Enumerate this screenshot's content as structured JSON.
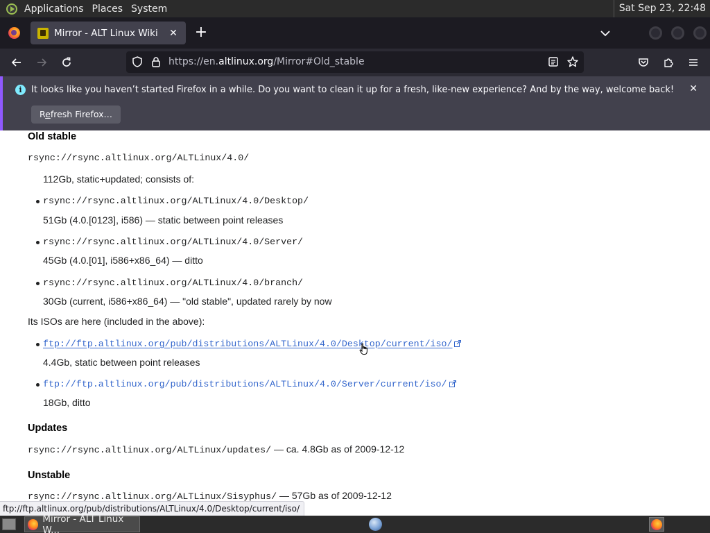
{
  "desktop": {
    "menu": [
      "Applications",
      "Places",
      "System"
    ],
    "clock": "Sat Sep 23, 22:48"
  },
  "browser": {
    "tab_title": "Mirror - ALT Linux Wiki",
    "url_scheme": "https://en.",
    "url_host": "altlinux.org",
    "url_path": "/Mirror#Old_stable",
    "notification": {
      "message": "It looks like you haven’t started Firefox in a while. Do you want to clean it up for a fresh, like-new experience? And by the way, welcome back!",
      "button_pre": "R",
      "button_accel": "e",
      "button_post": "fresh Firefox…"
    },
    "status_url": "ftp://ftp.altlinux.org/pub/distributions/ALTLinux/4.0/Desktop/current/iso/"
  },
  "page": {
    "old_stable": {
      "heading": "Old stable",
      "rsync": "rsync://rsync.altlinux.org/ALTLinux/4.0/",
      "summary": "112Gb, static+updated; consists of:",
      "items": [
        {
          "path": "rsync://rsync.altlinux.org/ALTLinux/4.0/Desktop/",
          "desc": "51Gb (4.0.[0123], i586) — static between point releases"
        },
        {
          "path": "rsync://rsync.altlinux.org/ALTLinux/4.0/Server/",
          "desc": "45Gb (4.0.[01], i586+x86_64) — ditto"
        },
        {
          "path": "rsync://rsync.altlinux.org/ALTLinux/4.0/branch/",
          "desc": "30Gb (current, i586+x86_64) — \"old stable\", updated rarely by now"
        }
      ],
      "isos_intro": "Its ISOs are here (included in the above):",
      "isos": [
        {
          "url": "ftp://ftp.altlinux.org/pub/distributions/ALTLinux/4.0/Desktop/current/iso/",
          "desc": "4.4Gb, static between point releases"
        },
        {
          "url": "ftp://ftp.altlinux.org/pub/distributions/ALTLinux/4.0/Server/current/iso/",
          "desc": "18Gb, ditto"
        }
      ]
    },
    "updates": {
      "heading": "Updates",
      "rsync": "rsync://rsync.altlinux.org/ALTLinux/updates/",
      "note": " — ca. 4.8Gb as of 2009-12-12"
    },
    "unstable": {
      "heading": "Unstable",
      "rsync": "rsync://rsync.altlinux.org/ALTLinux/Sisyphus/",
      "note": " — 57Gb as of 2009-12-12"
    }
  },
  "taskbar": {
    "window_label": "Mirror - ALT Linux W..."
  },
  "colors": {
    "link": "#3366cc",
    "accent": "#9059ff",
    "info": "#80ebff"
  }
}
